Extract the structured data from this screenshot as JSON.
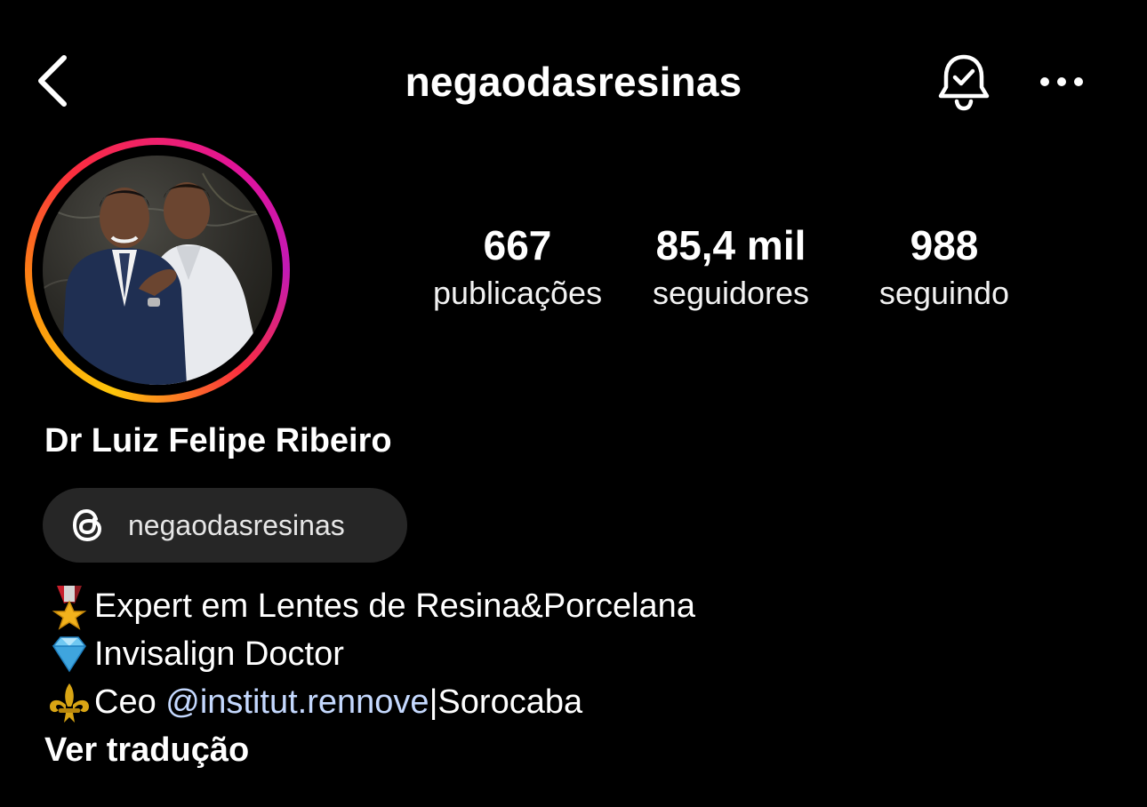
{
  "header": {
    "username": "negaodasresinas",
    "back_icon": "chevron-left-icon",
    "notification_icon": "bell-check-icon",
    "more_icon": "more-horizontal-icon"
  },
  "stats": [
    {
      "value": "667",
      "label": "publicações"
    },
    {
      "value": "85,4 mil",
      "label": "seguidores"
    },
    {
      "value": "988",
      "label": "seguindo"
    }
  ],
  "profile": {
    "name": "Dr Luiz Felipe Ribeiro",
    "threads": {
      "icon": "threads-icon",
      "label": "negaodasresinas"
    },
    "bio": {
      "line1": {
        "emoji": "medal-icon",
        "text": "Expert em Lentes de Resina&Porcelana"
      },
      "line2": {
        "emoji": "diamond-icon",
        "text": "Invisalign Doctor"
      },
      "line3": {
        "emoji": "fleur-de-lis-icon",
        "prefix": "Ceo ",
        "mention": "@institut.rennove",
        "suffix": "|Sorocaba"
      }
    },
    "translate_label": "Ver tradução"
  },
  "colors": {
    "background": "#000000",
    "text": "#ffffff",
    "mention": "#c5d9ff",
    "pill": "#262626",
    "story_ring": [
      "#fdc50a",
      "#fb2d3f",
      "#e1139c",
      "#c21ab4"
    ]
  }
}
